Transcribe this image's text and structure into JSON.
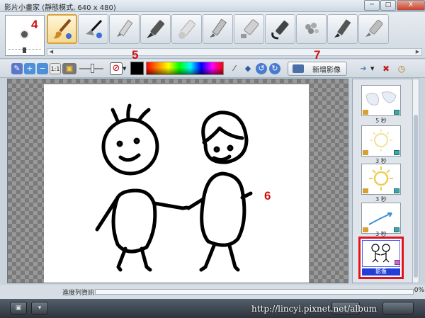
{
  "window": {
    "title": "影片小畫家 (靜態模式, 640 x 480)",
    "buttons": [
      "─",
      "□",
      "X"
    ]
  },
  "annotations": {
    "a4": "4",
    "a5": "5",
    "a6": "6",
    "a7": "7"
  },
  "toolbar": {
    "tools": [
      "paintbrush",
      "stamp",
      "pencil",
      "marker",
      "chalk",
      "crayon",
      "highlighter",
      "eraser",
      "sprayer",
      "pastel",
      "oil-brush"
    ],
    "selected_tool": "paintbrush"
  },
  "colorbar": {
    "add_image_label": "新增影像",
    "selected_color": "#000000"
  },
  "frames": [
    {
      "label": "5 秒"
    },
    {
      "label": "3 秒"
    },
    {
      "label": "3 秒"
    },
    {
      "label": "3 秒"
    },
    {
      "label": "影像"
    }
  ],
  "status": {
    "label": "進度列資訊",
    "progress": "0%"
  },
  "footer": {
    "url": "http://lincyi.pixnet.net/album"
  }
}
